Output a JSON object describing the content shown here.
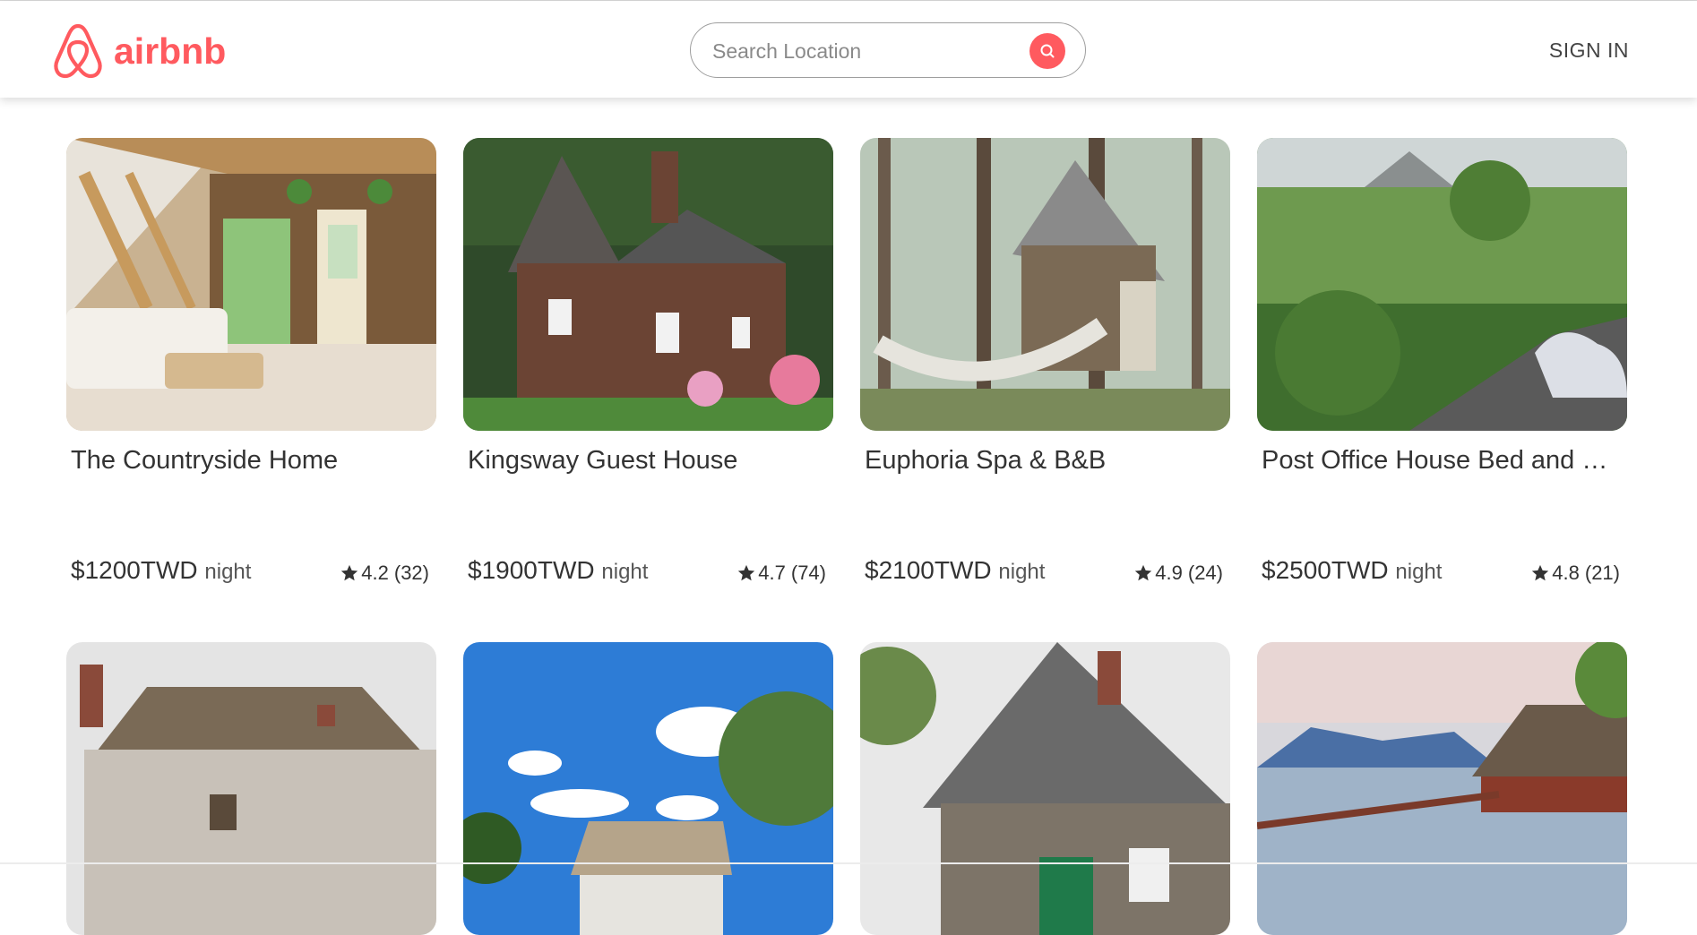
{
  "brand": {
    "name": "airbnb",
    "color": "#ff5a5f"
  },
  "search": {
    "placeholder": "Search Location"
  },
  "nav": {
    "signin_label": "SIGN IN"
  },
  "listings": [
    {
      "title": "The Countryside Home",
      "price": "$1200TWD",
      "unit": "night",
      "rating": "4.2",
      "reviews": "(32)",
      "photo": "cozy a-frame living room interior"
    },
    {
      "title": "Kingsway Guest House",
      "price": "$1900TWD",
      "unit": "night",
      "rating": "4.7",
      "reviews": "(74)",
      "photo": "stone cottage with garden"
    },
    {
      "title": "Euphoria Spa & B&B",
      "price": "$2100TWD",
      "unit": "night",
      "rating": "4.9",
      "reviews": "(24)",
      "photo": "forest cabin with hammock"
    },
    {
      "title": "Post Office House Bed and Breakfast",
      "price": "$2500TWD",
      "unit": "night",
      "rating": "4.8",
      "reviews": "(21)",
      "photo": "tropical jungle view"
    },
    {
      "title": "",
      "price": "",
      "unit": "",
      "rating": "",
      "reviews": "",
      "photo": "thatched roof cottage"
    },
    {
      "title": "",
      "price": "",
      "unit": "",
      "rating": "",
      "reviews": "",
      "photo": "blue sky with house roof"
    },
    {
      "title": "",
      "price": "",
      "unit": "",
      "rating": "",
      "reviews": "",
      "photo": "old wooden barn house"
    },
    {
      "title": "",
      "price": "",
      "unit": "",
      "rating": "",
      "reviews": "",
      "photo": "lake house with mountains"
    }
  ]
}
